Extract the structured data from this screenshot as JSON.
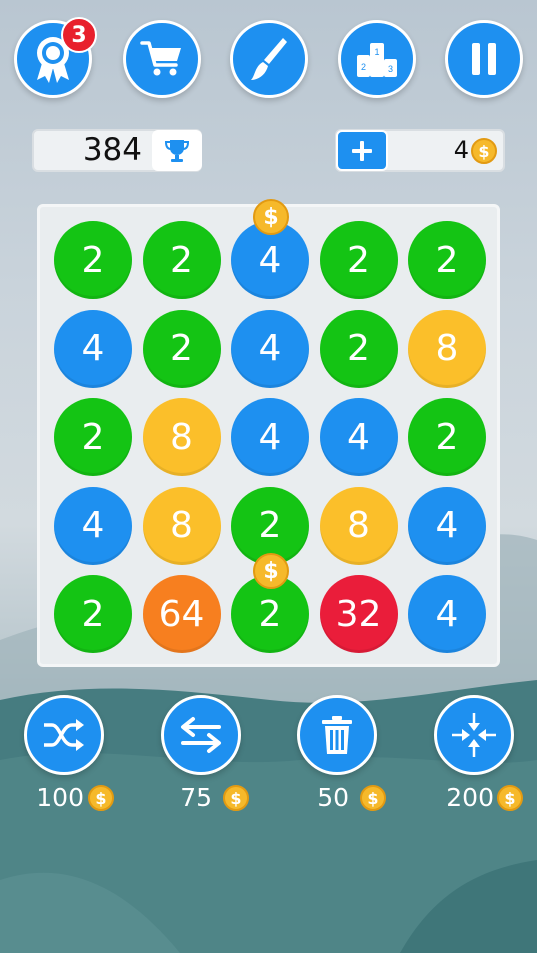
{
  "colors": {
    "blue": "#1e90f0",
    "green": "#14c414",
    "yellow": "#fbbf2a",
    "orange": "#f77f1f",
    "red": "#ea1d3a",
    "coin": "#f6b92b"
  },
  "top_bar": {
    "buttons": [
      {
        "icon": "award-ribbon-icon",
        "name": "achievements-button"
      },
      {
        "icon": "cart-icon",
        "name": "shop-button"
      },
      {
        "icon": "brush-icon",
        "name": "theme-button"
      },
      {
        "icon": "podium-icon",
        "name": "leaderboard-button"
      },
      {
        "icon": "pause-icon",
        "name": "pause-button"
      }
    ],
    "achievements_badge": "3"
  },
  "score": {
    "value": "384",
    "icon": "trophy-icon"
  },
  "coins": {
    "add_icon": "plus-icon",
    "count": "4",
    "coin_icon": "coin-icon",
    "coin_symbol": "$"
  },
  "board": {
    "rows": [
      [
        {
          "value": "2",
          "color": "green"
        },
        {
          "value": "2",
          "color": "green"
        },
        {
          "value": "4",
          "color": "blue",
          "coin": true
        },
        {
          "value": "2",
          "color": "green"
        },
        {
          "value": "2",
          "color": "green"
        }
      ],
      [
        {
          "value": "4",
          "color": "blue"
        },
        {
          "value": "2",
          "color": "green"
        },
        {
          "value": "4",
          "color": "blue"
        },
        {
          "value": "2",
          "color": "green"
        },
        {
          "value": "8",
          "color": "yellow"
        }
      ],
      [
        {
          "value": "2",
          "color": "green"
        },
        {
          "value": "8",
          "color": "yellow"
        },
        {
          "value": "4",
          "color": "blue"
        },
        {
          "value": "4",
          "color": "blue"
        },
        {
          "value": "2",
          "color": "green"
        }
      ],
      [
        {
          "value": "4",
          "color": "blue"
        },
        {
          "value": "8",
          "color": "yellow"
        },
        {
          "value": "2",
          "color": "green"
        },
        {
          "value": "8",
          "color": "yellow"
        },
        {
          "value": "4",
          "color": "blue"
        }
      ],
      [
        {
          "value": "2",
          "color": "green"
        },
        {
          "value": "64",
          "color": "orange"
        },
        {
          "value": "2",
          "color": "green",
          "coin": true
        },
        {
          "value": "32",
          "color": "red"
        },
        {
          "value": "4",
          "color": "blue"
        }
      ]
    ]
  },
  "powerups": [
    {
      "name": "shuffle",
      "icon": "shuffle-icon",
      "cost": "100"
    },
    {
      "name": "swap",
      "icon": "swap-arrows-icon",
      "cost": "75"
    },
    {
      "name": "delete",
      "icon": "trash-icon",
      "cost": "50"
    },
    {
      "name": "collapse",
      "icon": "collapse-arrows-icon",
      "cost": "200"
    }
  ]
}
